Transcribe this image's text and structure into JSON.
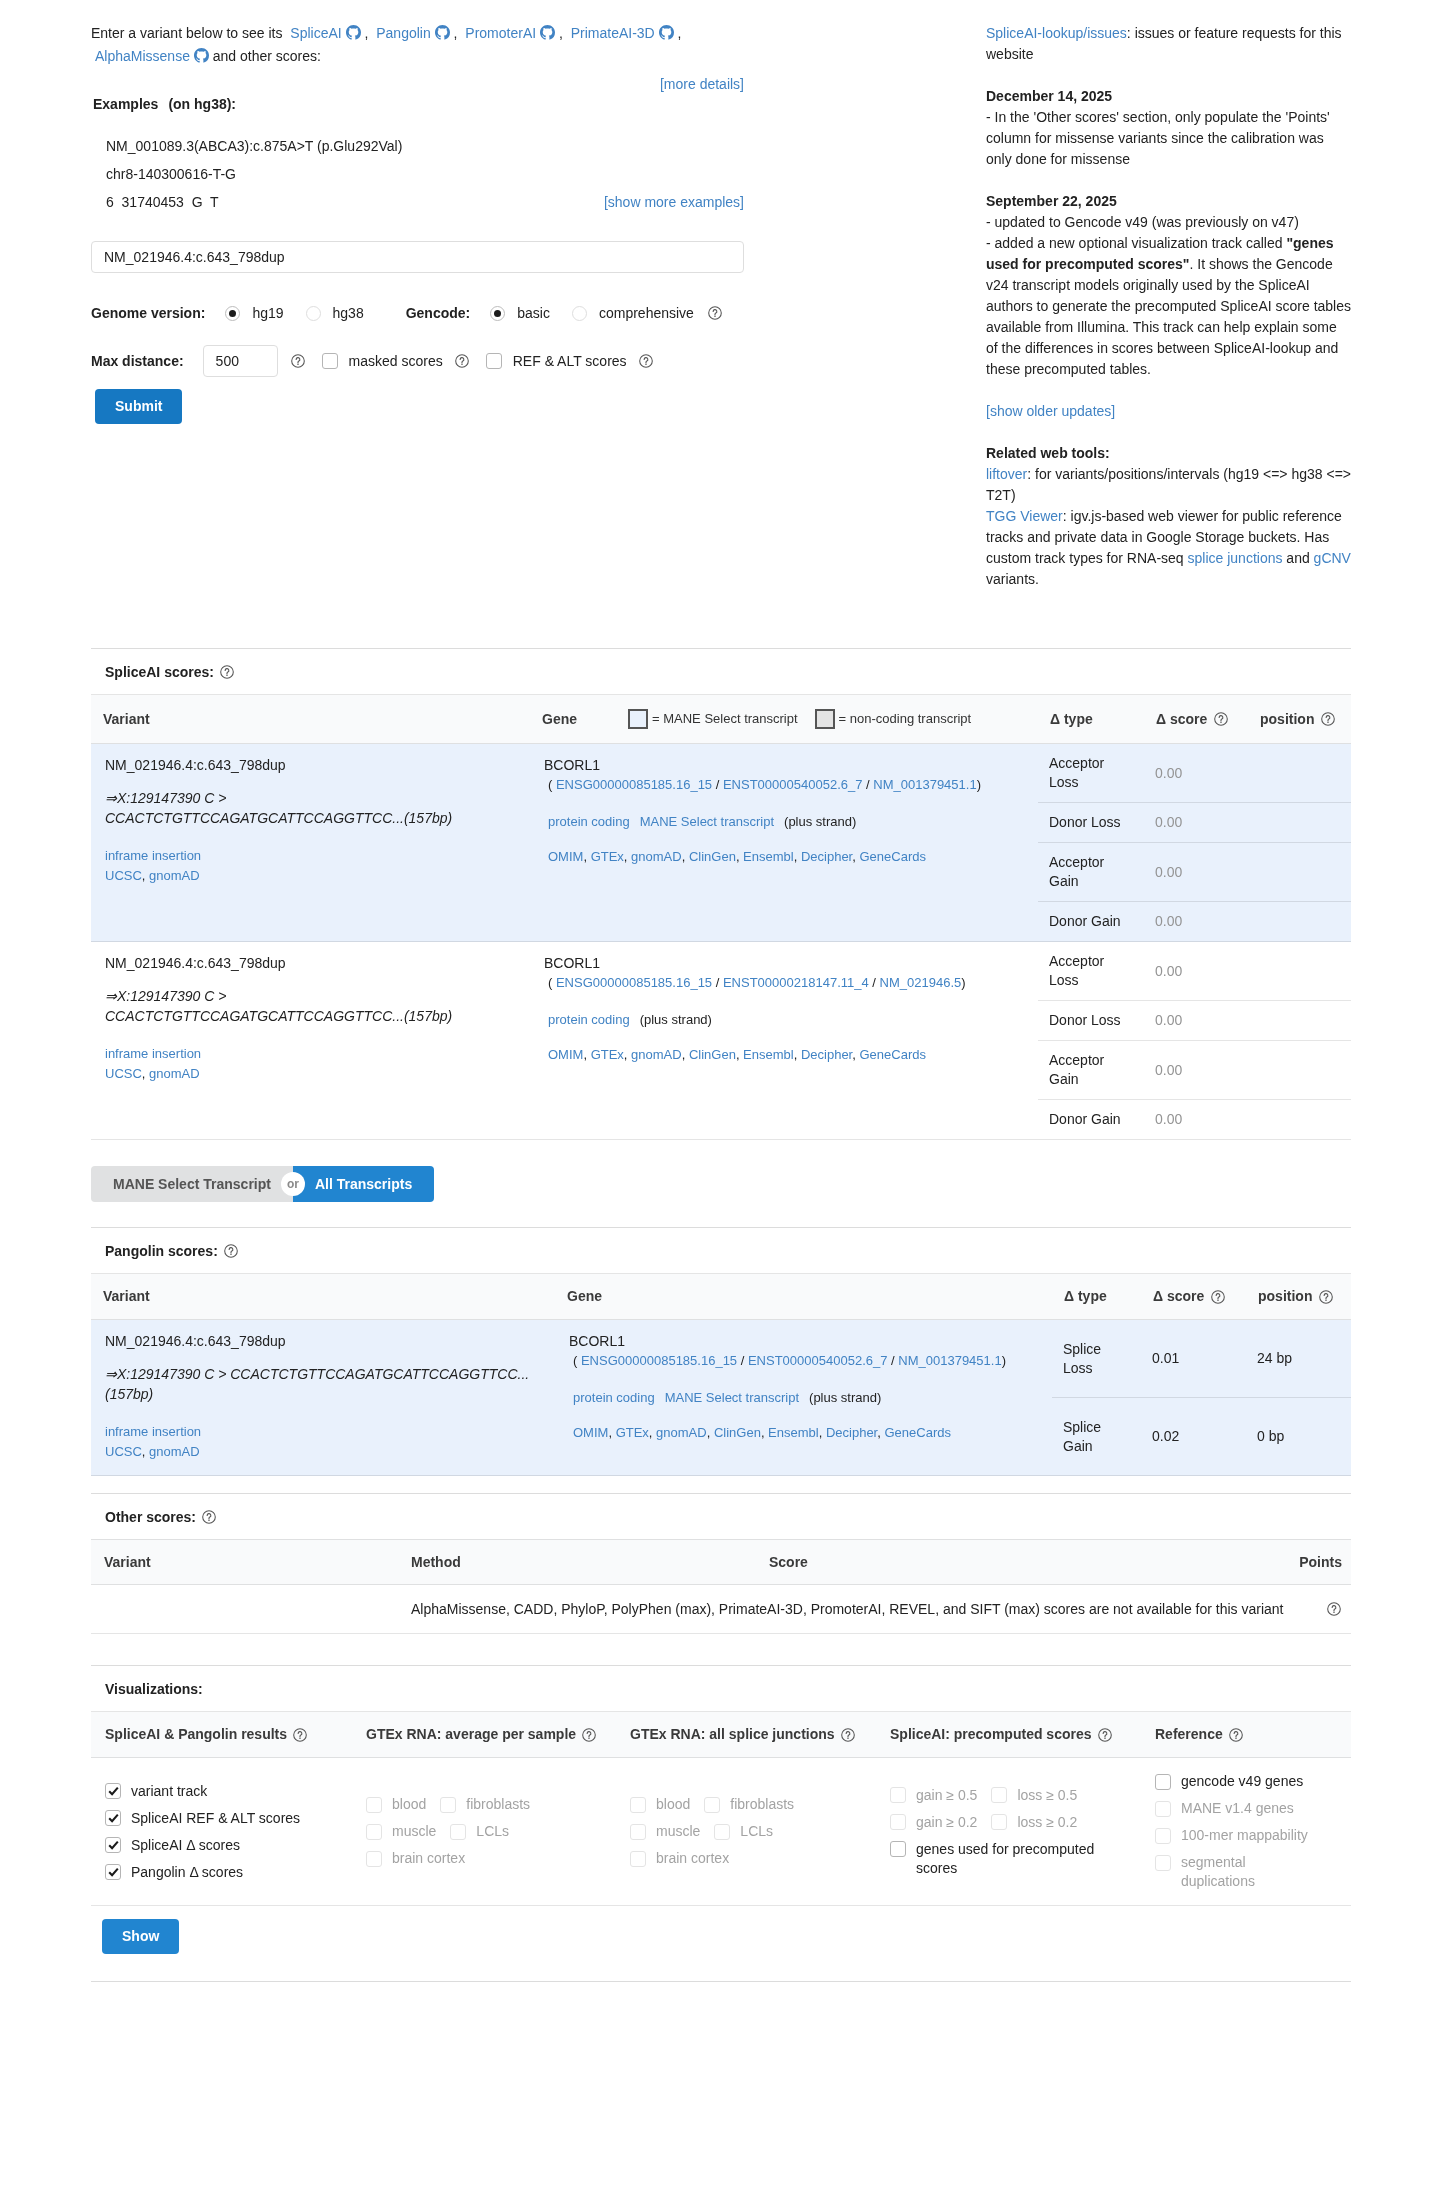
{
  "intro": {
    "lead": "Enter a variant below to see its",
    "tools": [
      {
        "label": "SpliceAI",
        "separator": ","
      },
      {
        "label": "Pangolin",
        "separator": ","
      },
      {
        "label": "PromoterAI",
        "separator": ","
      },
      {
        "label": "PrimateAI-3D",
        "separator": ","
      },
      {
        "label": "AlphaMissense"
      }
    ],
    "tail": "and other scores:"
  },
  "more_details": "[more details]",
  "examples": {
    "title": "Examples",
    "note": "(on hg38):",
    "items": [
      "NM_001089.3(ABCA3):c.875A>T (p.Glu292Val)",
      "chr8-140300616-T-G",
      "6  31740453  G  T"
    ],
    "more": "[show more examples]"
  },
  "variant_input": {
    "value": "NM_021946.4:c.643_798dup"
  },
  "genome_version": {
    "label": "Genome version:",
    "options": [
      {
        "label": "hg19",
        "selected": true
      },
      {
        "label": "hg38",
        "selected": false
      }
    ]
  },
  "gencode": {
    "label": "Gencode:",
    "help": true,
    "options": [
      {
        "label": "basic",
        "selected": true
      },
      {
        "label": "comprehensive",
        "selected": false
      }
    ]
  },
  "max_distance": {
    "label": "Max distance:",
    "value": "500",
    "help": true
  },
  "score_options": [
    {
      "label": "masked scores",
      "checked": false,
      "help": true
    },
    {
      "label": "REF & ALT scores",
      "checked": false,
      "help": true
    }
  ],
  "submit": "Submit",
  "news": {
    "issues": {
      "link": "SpliceAI-lookup/issues",
      "text": ": issues or feature requests for this website"
    },
    "updates": [
      {
        "date": "December 14, 2025",
        "lines": [
          "- In the 'Other scores' section, only populate the 'Points' column for missense variants since the calibration was only done for missense"
        ]
      },
      {
        "date": "September 22, 2025",
        "lines": [
          "- updated to Gencode v49 (was previously on v47)",
          "- added a new optional visualization track called **\"genes used for precomputed scores\"**. It shows the Gencode v24 transcript models originally used by the SpliceAI authors to generate the precomputed SpliceAI score tables available from Illumina. This track can help explain some of the differences in scores between SpliceAI-lookup and these precomputed tables."
        ]
      }
    ],
    "older": "[show older updates]",
    "related": {
      "title": "Related web tools:",
      "items": [
        {
          "parts": [
            {
              "kind": "link",
              "text": "liftover"
            },
            {
              "kind": "text",
              "text": ": for variants/positions/intervals (hg19 <=> hg38 <=> T2T)"
            }
          ]
        },
        {
          "parts": [
            {
              "kind": "link",
              "text": "TGG Viewer"
            },
            {
              "kind": "text",
              "text": ": igv.js-based web viewer for public reference tracks and private data in Google Storage buckets. Has custom track types for RNA-seq "
            },
            {
              "kind": "link",
              "text": "splice junctions"
            },
            {
              "kind": "text",
              "text": " and "
            },
            {
              "kind": "link",
              "text": "gCNV"
            },
            {
              "kind": "text",
              "text": " variants."
            }
          ]
        }
      ]
    }
  },
  "spliceai": {
    "title": "SpliceAI scores:",
    "help": true,
    "columns": [
      {
        "label": "Variant",
        "help": false
      },
      {
        "label": "Gene",
        "help": false
      },
      {
        "label": "Δ type",
        "help": false
      },
      {
        "label": "Δ score",
        "help": true
      },
      {
        "label": "position",
        "help": true
      }
    ],
    "legend": [
      {
        "label": "= MANE Select transcript",
        "color": "#e9f1fc"
      },
      {
        "label": "= non-coding transcript",
        "color": "#e4e4e4"
      }
    ],
    "rows": [
      {
        "mane_select": true,
        "variant": "NM_021946.4:c.643_798dup",
        "change": "⇒X:129147390 C > CCACTCTGTTCCAGATGCATTCCAGGTTCC...(157bp)",
        "consequence": "inframe insertion",
        "links": {
          "items": [
            "UCSC",
            "gnomAD"
          ],
          "separator": ","
        },
        "gene": "BCORL1",
        "ids": {
          "open": "(",
          "items": [
            "ENSG00000085185.16_15",
            "ENST00000540052.6_7",
            "NM_001379451.1"
          ],
          "separator": "/",
          "close": ")"
        },
        "biotypes": [
          "protein coding",
          "MANE Select transcript"
        ],
        "strand": "(plus strand)",
        "gene_links": {
          "items": [
            "OMIM",
            "GTEx",
            "gnomAD",
            "ClinGen",
            "Ensembl",
            "Decipher",
            "GeneCards"
          ],
          "separator": ","
        },
        "scores": [
          {
            "type": "Acceptor Loss",
            "score": "0.00",
            "muted": true
          },
          {
            "type": "Donor Loss",
            "score": "0.00",
            "muted": true
          },
          {
            "type": "Acceptor Gain",
            "score": "0.00",
            "muted": true
          },
          {
            "type": "Donor Gain",
            "score": "0.00",
            "muted": true
          }
        ]
      },
      {
        "mane_select": false,
        "variant": "NM_021946.4:c.643_798dup",
        "change": "⇒X:129147390 C > CCACTCTGTTCCAGATGCATTCCAGGTTCC...(157bp)",
        "consequence": "inframe insertion",
        "links": {
          "items": [
            "UCSC",
            "gnomAD"
          ],
          "separator": ","
        },
        "gene": "BCORL1",
        "ids": {
          "open": "(",
          "items": [
            "ENSG00000085185.16_15",
            "ENST00000218147.11_4",
            "NM_021946.5"
          ],
          "separator": "/",
          "close": ")"
        },
        "biotypes": [
          "protein coding"
        ],
        "strand": "(plus strand)",
        "gene_links": {
          "items": [
            "OMIM",
            "GTEx",
            "gnomAD",
            "ClinGen",
            "Ensembl",
            "Decipher",
            "GeneCards"
          ],
          "separator": ","
        },
        "scores": [
          {
            "type": "Acceptor Loss",
            "score": "0.00",
            "muted": true
          },
          {
            "type": "Donor Loss",
            "score": "0.00",
            "muted": true
          },
          {
            "type": "Acceptor Gain",
            "score": "0.00",
            "muted": true
          },
          {
            "type": "Donor Gain",
            "score": "0.00",
            "muted": true
          }
        ]
      }
    ]
  },
  "transcript_toggle": {
    "options": [
      {
        "label": "MANE Select Transcript",
        "selected": false
      },
      {
        "label": "All Transcripts",
        "selected": true
      }
    ],
    "divider": "or"
  },
  "pangolin": {
    "title": "Pangolin scores:",
    "help": true,
    "columns": [
      {
        "label": "Variant",
        "help": false
      },
      {
        "label": "Gene",
        "help": false
      },
      {
        "label": "Δ type",
        "help": false
      },
      {
        "label": "Δ score",
        "help": true
      },
      {
        "label": "position",
        "help": true
      }
    ],
    "rows": [
      {
        "mane_select": true,
        "variant": "NM_021946.4:c.643_798dup",
        "change": "⇒X:129147390 C > CCACTCTGTTCCAGATGCATTCCAGGTTCC...(157bp)",
        "consequence": "inframe insertion",
        "links": {
          "items": [
            "UCSC",
            "gnomAD"
          ],
          "separator": ","
        },
        "gene": "BCORL1",
        "ids": {
          "open": "(",
          "items": [
            "ENSG00000085185.16_15",
            "ENST00000540052.6_7",
            "NM_001379451.1"
          ],
          "separator": "/",
          "close": ")"
        },
        "biotypes": [
          "protein coding",
          "MANE Select transcript"
        ],
        "strand": "(plus strand)",
        "gene_links": {
          "items": [
            "OMIM",
            "GTEx",
            "gnomAD",
            "ClinGen",
            "Ensembl",
            "Decipher",
            "GeneCards"
          ],
          "separator": ","
        },
        "scores": [
          {
            "type": "Splice Loss",
            "score": "0.01",
            "muted": false,
            "position": "24 bp"
          },
          {
            "type": "Splice Gain",
            "score": "0.02",
            "muted": false,
            "position": "0 bp"
          }
        ]
      }
    ]
  },
  "other_scores": {
    "title": "Other scores:",
    "help": true,
    "columns": [
      "Variant",
      "Method",
      "Score",
      "Points"
    ],
    "message": "AlphaMissense, CADD, PhyloP, PolyPhen (max), PrimateAI-3D, PromoterAI, REVEL, and SIFT (max) scores are not available for this variant",
    "message_help": true
  },
  "visualizations": {
    "title": "Visualizations:",
    "groups": [
      {
        "title": "SpliceAI & Pangolin results",
        "help": true,
        "rows": [
          [
            {
              "label": "variant track",
              "checked": true,
              "disabled": false
            }
          ],
          [
            {
              "label": "SpliceAI REF & ALT scores",
              "checked": true,
              "disabled": false
            }
          ],
          [
            {
              "label": "SpliceAI Δ scores",
              "checked": true,
              "disabled": false
            }
          ],
          [
            {
              "label": "Pangolin Δ scores",
              "checked": true,
              "disabled": false
            }
          ]
        ]
      },
      {
        "title": "GTEx RNA: average per sample",
        "help": true,
        "rows": [
          [
            {
              "label": "blood",
              "checked": false,
              "disabled": true
            },
            {
              "label": "fibroblasts",
              "checked": false,
              "disabled": true
            }
          ],
          [
            {
              "label": "muscle",
              "checked": false,
              "disabled": true
            },
            {
              "label": "LCLs",
              "checked": false,
              "disabled": true
            }
          ],
          [
            {
              "label": "brain cortex",
              "checked": false,
              "disabled": true
            }
          ]
        ]
      },
      {
        "title": "GTEx RNA: all splice junctions",
        "help": true,
        "rows": [
          [
            {
              "label": "blood",
              "checked": false,
              "disabled": true
            },
            {
              "label": "fibroblasts",
              "checked": false,
              "disabled": true
            }
          ],
          [
            {
              "label": "muscle",
              "checked": false,
              "disabled": true
            },
            {
              "label": "LCLs",
              "checked": false,
              "disabled": true
            }
          ],
          [
            {
              "label": "brain cortex",
              "checked": false,
              "disabled": true
            }
          ]
        ]
      },
      {
        "title": "SpliceAI: precomputed scores",
        "help": true,
        "rows": [
          [
            {
              "label": "gain ≥ 0.5",
              "checked": false,
              "disabled": true
            },
            {
              "label": "loss ≥ 0.5",
              "checked": false,
              "disabled": true
            }
          ],
          [
            {
              "label": "gain ≥ 0.2",
              "checked": false,
              "disabled": true
            },
            {
              "label": "loss ≥ 0.2",
              "checked": false,
              "disabled": true
            }
          ],
          [
            {
              "label": "genes used for precomputed scores",
              "checked": false,
              "disabled": false
            }
          ]
        ]
      },
      {
        "title": "Reference",
        "help": true,
        "rows": [
          [
            {
              "label": "gencode v49 genes",
              "checked": false,
              "disabled": false
            }
          ],
          [
            {
              "label": "MANE v1.4 genes",
              "checked": false,
              "disabled": true
            }
          ],
          [
            {
              "label": "100-mer mappability",
              "checked": false,
              "disabled": true
            }
          ],
          [
            {
              "label": "segmental duplications",
              "checked": false,
              "disabled": true
            }
          ]
        ]
      }
    ],
    "button": "Show"
  }
}
